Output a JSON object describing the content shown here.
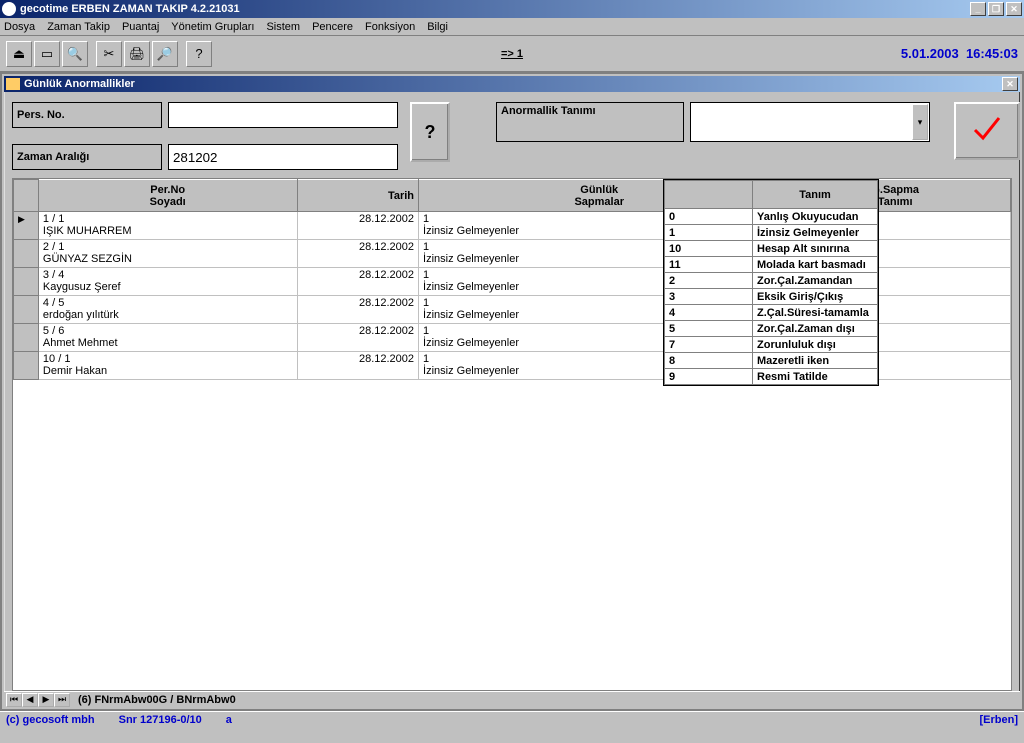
{
  "app": {
    "title": "gecotime  ERBEN ZAMAN TAKIP  4.2.21031",
    "winbtns": {
      "min": "_",
      "max": "❐",
      "close": "✕"
    }
  },
  "menu": [
    "Dosya",
    "Zaman Takip",
    "Puantaj",
    "Yönetim Grupları",
    "Sistem",
    "Pencere",
    "Fonksiyon",
    "Bilgi"
  ],
  "toolbar": {
    "center_label": "=> 1",
    "date": "5.01.2003",
    "time": "16:45:03"
  },
  "child": {
    "title": "Günlük Anormallikler",
    "close": "✕",
    "labels": {
      "persno": "Pers. No.",
      "zaman": "Zaman Aralığı",
      "anorm": "Anormallik Tanımı"
    },
    "inputs": {
      "persno": "",
      "zaman": "281202",
      "anorm": ""
    },
    "qbtn": "?",
    "okbtn": "✔"
  },
  "grid": {
    "headers": {
      "rowhead": "",
      "per": "Per.No\nSoyadı",
      "tarih": "Tarih",
      "gun": "Günlük\nSapmalar",
      "sapma": "G.Sapma\nTanımı"
    },
    "rows": [
      {
        "sel": true,
        "per1": "1 / 1",
        "per2": "IŞIK MUHARREM",
        "tarih": "28.12.2002",
        "g1": "1",
        "g2": "İzinsiz Gelmeyenler",
        "sap": ""
      },
      {
        "sel": false,
        "per1": "2 / 1",
        "per2": "GÜNYAZ SEZGİN",
        "tarih": "28.12.2002",
        "g1": "1",
        "g2": "İzinsiz Gelmeyenler",
        "sap": ""
      },
      {
        "sel": false,
        "per1": "3 / 4",
        "per2": "Kaygusuz Şeref",
        "tarih": "28.12.2002",
        "g1": "1",
        "g2": "İzinsiz Gelmeyenler",
        "sap": ""
      },
      {
        "sel": false,
        "per1": "4 / 5",
        "per2": "erdoğan yılıtürk",
        "tarih": "28.12.2002",
        "g1": "1",
        "g2": "İzinsiz Gelmeyenler",
        "sap": ""
      },
      {
        "sel": false,
        "per1": "5 / 6",
        "per2": "Ahmet Mehmet",
        "tarih": "28.12.2002",
        "g1": "1",
        "g2": "İzinsiz Gelmeyenler",
        "sap": ""
      },
      {
        "sel": false,
        "per1": "10 / 1",
        "per2": "Demir Hakan",
        "tarih": "28.12.2002",
        "g1": "1",
        "g2": "İzinsiz Gelmeyenler",
        "sap": ""
      }
    ]
  },
  "dropdown": {
    "header_blank": "",
    "header_tanim": "Tanım",
    "rows": [
      {
        "id": "0",
        "txt": "Yanlış Okuyucudan"
      },
      {
        "id": "1",
        "txt": "İzinsiz Gelmeyenler"
      },
      {
        "id": "10",
        "txt": "Hesap Alt sınırına"
      },
      {
        "id": "11",
        "txt": "Molada kart basmadı"
      },
      {
        "id": "2",
        "txt": "Zor.Çal.Zamandan"
      },
      {
        "id": "3",
        "txt": "Eksik Giriş/Çıkış"
      },
      {
        "id": "4",
        "txt": "Z.Çal.Süresi-tamamla"
      },
      {
        "id": "5",
        "txt": "Zor.Çal.Zaman dışı"
      },
      {
        "id": "7",
        "txt": "Zorunluluk dışı"
      },
      {
        "id": "8",
        "txt": "Mazeretli iken"
      },
      {
        "id": "9",
        "txt": "Resmi Tatilde"
      }
    ]
  },
  "nav": {
    "label": "(6)  FNrmAbw00G / BNrmAbw0"
  },
  "status": {
    "copyright": "(c) gecosoft mbh",
    "snr": "Snr 127196-0/10",
    "a": "a",
    "erben": "[Erben]"
  }
}
